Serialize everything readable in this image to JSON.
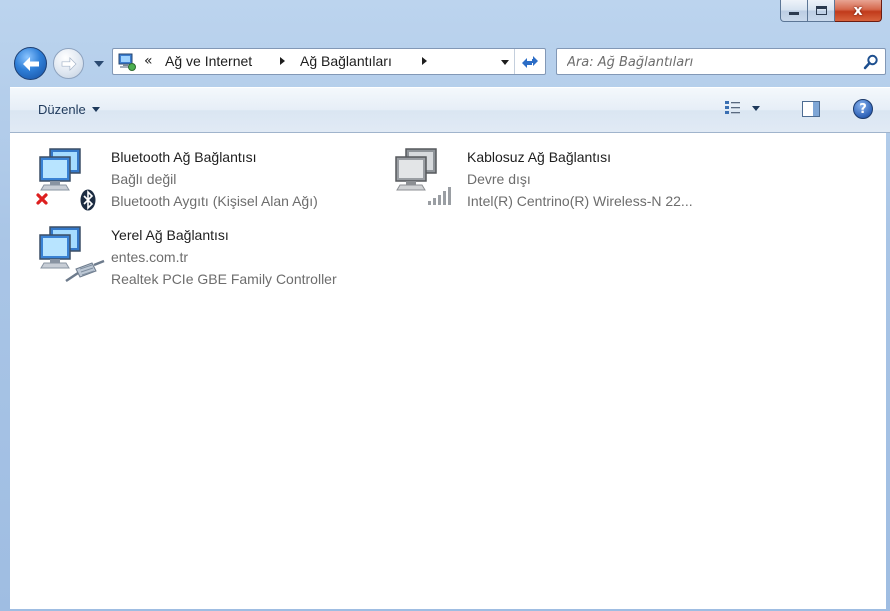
{
  "window": {
    "caption_buttons": [
      "minimize",
      "maximize",
      "close"
    ],
    "close_glyph": "x"
  },
  "nav": {
    "back_icon": "back-arrow-icon",
    "forward_icon": "forward-arrow-icon",
    "address": {
      "chevron": "«",
      "crumbs": [
        "Ağ ve Internet",
        "Ağ Bağlantıları"
      ]
    },
    "search": {
      "placeholder": "Ara: Ağ Bağlantıları"
    }
  },
  "toolbar": {
    "organize_label": "Düzenle",
    "help_label": "?"
  },
  "connections": [
    {
      "name": "Bluetooth Ağ Bağlantısı",
      "status": "Bağlı değil",
      "device": "Bluetooth Aygıtı (Kişisel Alan Ağı)",
      "overlay": "bluetooth-icon"
    },
    {
      "name": "Kablosuz Ağ Bağlantısı",
      "status": "Devre dışı",
      "device": "Intel(R) Centrino(R) Wireless-N 22...",
      "overlay": "wifi-signal-icon"
    },
    {
      "name": "Yerel Ağ Bağlantısı",
      "status": "entes.com.tr",
      "device": "Realtek PCIe GBE Family Controller",
      "overlay": "ethernet-cable-icon"
    }
  ],
  "colors": {
    "frame": "#a9c5e6",
    "secondary_text": "#6d6d6d",
    "toolbar_text": "#1e395b",
    "close_red": "#c13a1b"
  }
}
